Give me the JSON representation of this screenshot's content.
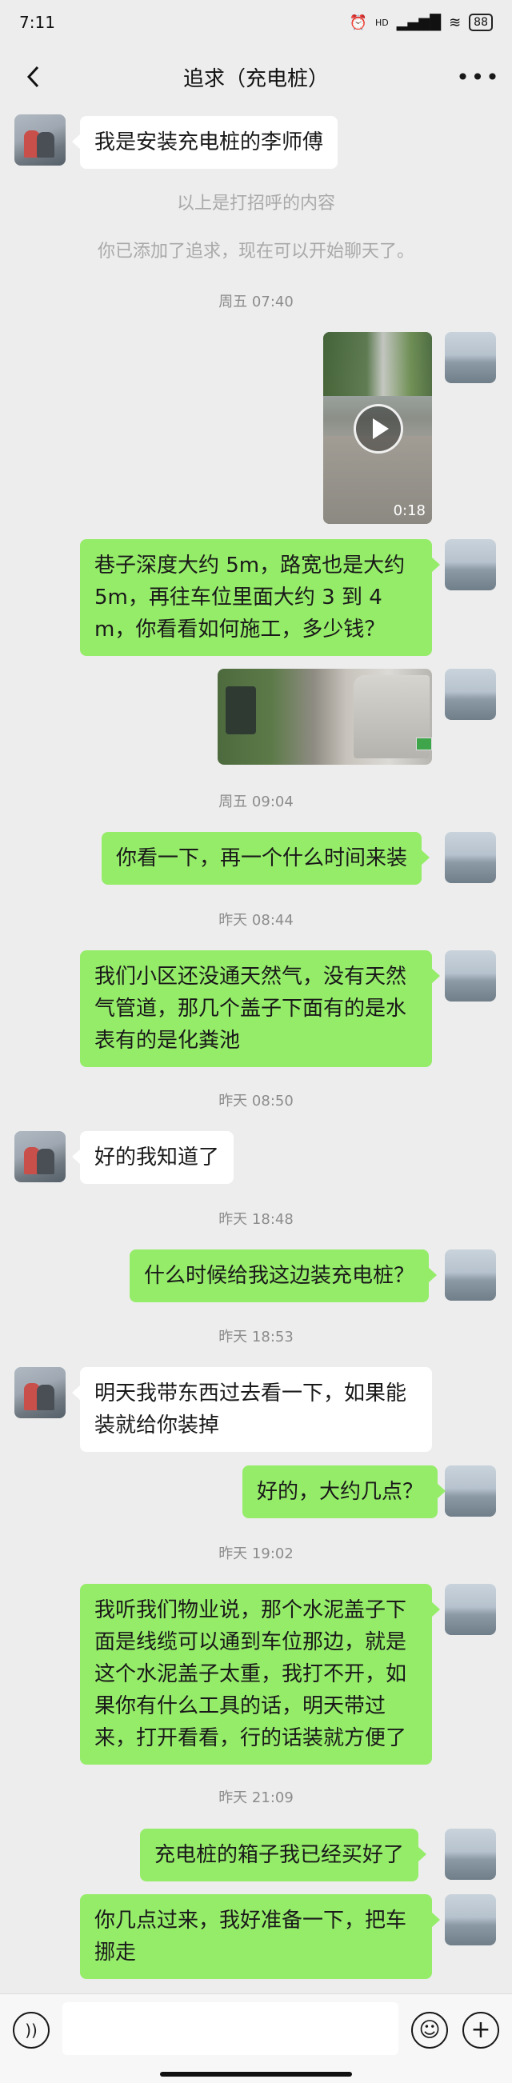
{
  "status_bar": {
    "time": "7:11",
    "icons": [
      "alarm-icon",
      "signal-icon",
      "wifi-icon",
      "battery-icon"
    ],
    "network_type": "HD",
    "battery": "88"
  },
  "header": {
    "title": "追求（充电桩）"
  },
  "messages": [
    {
      "side": "in",
      "type": "text",
      "text": "我是安装充电桩的李师傅"
    },
    {
      "type": "system",
      "text": "以上是打招呼的内容"
    },
    {
      "type": "system",
      "text": "你已添加了追求，现在可以开始聊天了。"
    },
    {
      "type": "time",
      "text": "周五 07:40"
    },
    {
      "side": "out",
      "type": "video",
      "duration": "0:18"
    },
    {
      "side": "out",
      "type": "text",
      "text": "巷子深度大约 5m，路宽也是大约 5m，再往车位里面大约 3 到 4m，你看看如何施工，多少钱？"
    },
    {
      "side": "out",
      "type": "image"
    },
    {
      "type": "time",
      "text": "周五 09:04"
    },
    {
      "side": "out",
      "type": "text",
      "text": "你看一下，再一个什么时间来装"
    },
    {
      "type": "time",
      "text": "昨天 08:44"
    },
    {
      "side": "out",
      "type": "text",
      "text": "我们小区还没通天然气，没有天然气管道，那几个盖子下面有的是水表有的是化粪池"
    },
    {
      "type": "time",
      "text": "昨天 08:50"
    },
    {
      "side": "in",
      "type": "text",
      "text": "好的我知道了"
    },
    {
      "type": "time",
      "text": "昨天 18:48"
    },
    {
      "side": "out",
      "type": "text",
      "text": "什么时候给我这边装充电桩？"
    },
    {
      "type": "time",
      "text": "昨天 18:53"
    },
    {
      "side": "in",
      "type": "text",
      "text": "明天我带东西过去看一下，如果能装就给你装掉"
    },
    {
      "side": "out",
      "type": "text",
      "text": "好的，大约几点？"
    },
    {
      "type": "time",
      "text": "昨天 19:02"
    },
    {
      "side": "out",
      "type": "text",
      "text": "我听我们物业说，那个水泥盖子下面是线缆可以通到车位那边，就是这个水泥盖子太重，我打不开，如果你有什么工具的话，明天带过来，打开看看，行的话装就方便了"
    },
    {
      "type": "time",
      "text": "昨天 21:09"
    },
    {
      "side": "out",
      "type": "text",
      "text": "充电桩的箱子我已经买好了"
    },
    {
      "side": "out",
      "type": "text",
      "text": "你几点过来，我好准备一下，把车挪走"
    }
  ],
  "input_bar": {
    "value": "",
    "icons": [
      "voice-icon",
      "emoji-icon",
      "plus-icon"
    ]
  },
  "colors": {
    "background": "#ededed",
    "outgoing_bubble": "#95ec69",
    "incoming_bubble": "#ffffff",
    "timestamp_text": "#8c8c8c"
  }
}
